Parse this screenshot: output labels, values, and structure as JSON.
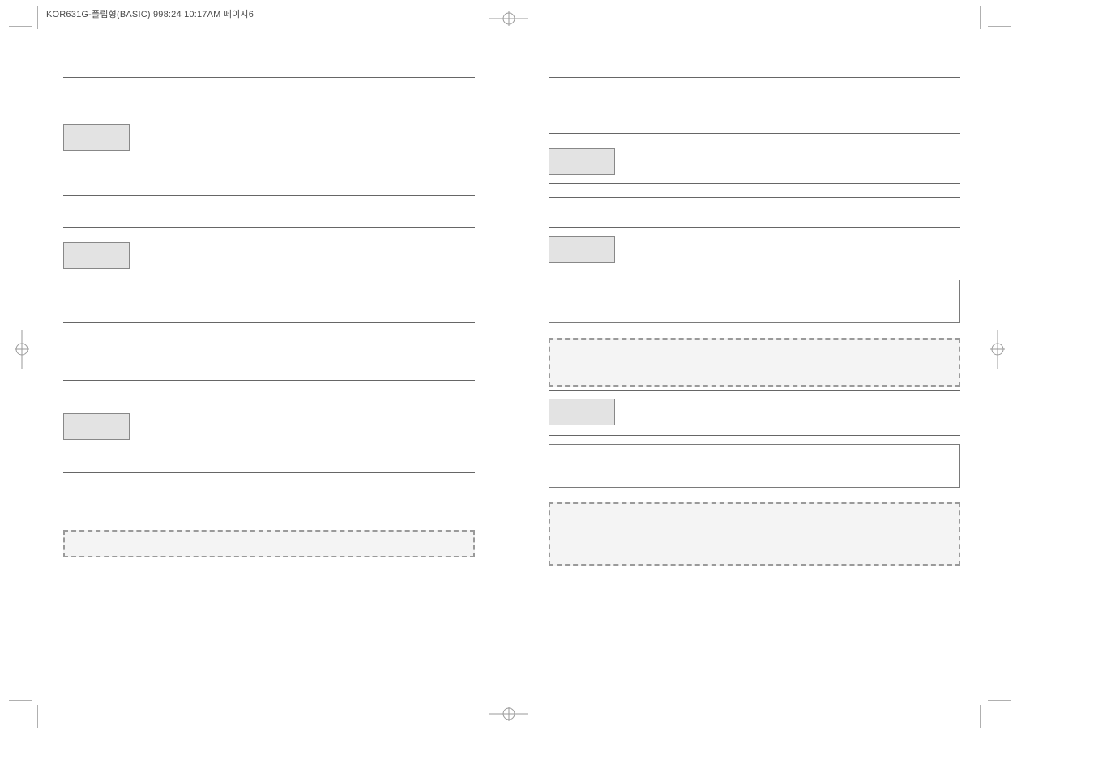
{
  "header": {
    "slug": "KOR631G-플립형(BASIC) 998:24 10:17AM 페이지6"
  },
  "left_column": {
    "sections": [
      {
        "chip": ""
      },
      {
        "chip": ""
      },
      {
        "chip": ""
      }
    ]
  },
  "right_column": {
    "sections": [
      {
        "chip": ""
      },
      {
        "chip": ""
      },
      {
        "chip": ""
      }
    ]
  }
}
